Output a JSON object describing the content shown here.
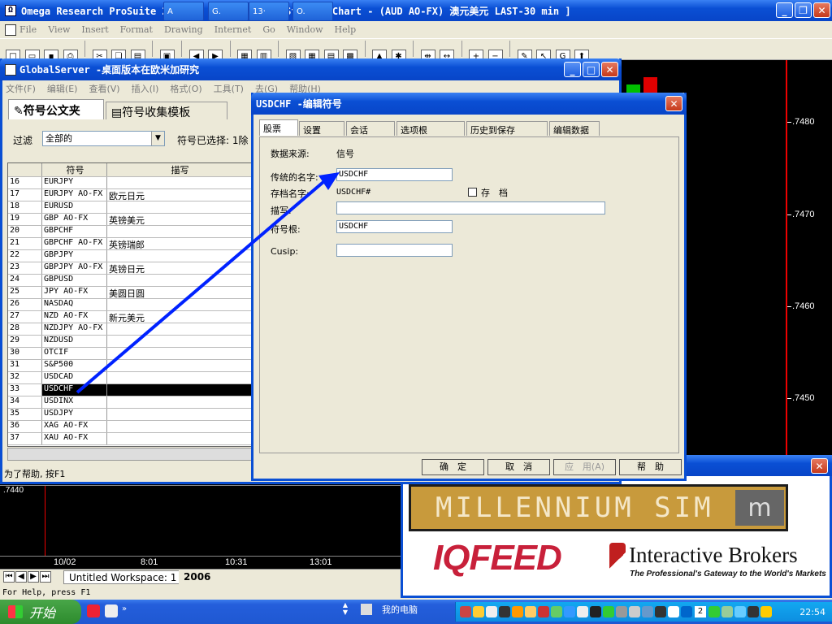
{
  "app": {
    "title": "Omega Research ProSuite 2000i - 2006 - [TradeStation Chart - (AUD AO-FX) 澳元美元 LAST-30 min ]",
    "menu": [
      "File",
      "View",
      "Insert",
      "Format",
      "Drawing",
      "Internet",
      "Go",
      "Window",
      "Help"
    ]
  },
  "chart": {
    "y_labels": [
      ".7480",
      ".7470",
      ".7460",
      ".7450"
    ],
    "lower_label": ".7440",
    "x_labels": [
      "10/02",
      "8:01",
      "10:31",
      "13:01"
    ],
    "up_color": "#00c000",
    "down_color": "#e00000"
  },
  "workspace_tabs": [
    "Untitled Workspace: 1",
    "2006"
  ],
  "status": {
    "left": "For Help, press F1"
  },
  "globalserver": {
    "title": "GlobalServer -桌面版本在欧米加研究",
    "menu": [
      "文件(F)",
      "编辑(E)",
      "查看(V)",
      "插入(I)",
      "格式(O)",
      "工具(T)",
      "去(G)",
      "帮助(H)"
    ],
    "tabs": [
      "符号公文夹",
      "符号收集模板"
    ],
    "filter_label": "过滤",
    "filter_value": "全部的",
    "selected_label": "符号已选择: 1除",
    "columns": [
      "符号",
      "描写"
    ],
    "rows": [
      {
        "n": "16",
        "s": "EURJPY",
        "d": ""
      },
      {
        "n": "17",
        "s": "EURJPY AO-FX",
        "d": "欧元日元"
      },
      {
        "n": "18",
        "s": "EURUSD",
        "d": ""
      },
      {
        "n": "19",
        "s": "GBP AO-FX",
        "d": "英镑美元"
      },
      {
        "n": "20",
        "s": "GBPCHF",
        "d": ""
      },
      {
        "n": "21",
        "s": "GBPCHF AO-FX",
        "d": "英镑瑞郎"
      },
      {
        "n": "22",
        "s": "GBPJPY",
        "d": ""
      },
      {
        "n": "23",
        "s": "GBPJPY AO-FX",
        "d": "英镑日元"
      },
      {
        "n": "24",
        "s": "GBPUSD",
        "d": ""
      },
      {
        "n": "25",
        "s": "JPY AO-FX",
        "d": "美圆日圆"
      },
      {
        "n": "26",
        "s": "NASDAQ",
        "d": ""
      },
      {
        "n": "27",
        "s": "NZD AO-FX",
        "d": "新元美元"
      },
      {
        "n": "28",
        "s": "NZDJPY AO-FX",
        "d": ""
      },
      {
        "n": "29",
        "s": "NZDUSD",
        "d": ""
      },
      {
        "n": "30",
        "s": "OTCIF",
        "d": ""
      },
      {
        "n": "31",
        "s": "S&P500",
        "d": ""
      },
      {
        "n": "32",
        "s": "USDCAD",
        "d": ""
      },
      {
        "n": "33",
        "s": "USDCHF",
        "d": ""
      },
      {
        "n": "34",
        "s": "USDINX",
        "d": ""
      },
      {
        "n": "35",
        "s": "USDJPY",
        "d": ""
      },
      {
        "n": "36",
        "s": "XAG AO-FX",
        "d": ""
      },
      {
        "n": "37",
        "s": "XAU AO-FX",
        "d": ""
      }
    ],
    "selected_index": 17,
    "status": "为了帮助, 按F1"
  },
  "dialog": {
    "title": "USDCHF -编辑符号",
    "tabs": [
      "股票",
      "设置",
      "会话",
      "选项根",
      "历史到保存",
      "编辑数据"
    ],
    "fields": {
      "source_label": "数据来源:",
      "source_value": "信号",
      "name_label": "传统的名字:",
      "name_value": "USDCHF",
      "archive_label": "存档名字:",
      "archive_value": "USDCHF#",
      "save_label": "存　档",
      "desc_label": "描写:",
      "desc_value": "",
      "root_label": "符号根:",
      "root_value": "USDCHF",
      "cusip_label": "Cusip:",
      "cusip_value": ""
    },
    "buttons": [
      "确　定",
      "取　消",
      "应　用(A)",
      "帮　助"
    ]
  },
  "ad": {
    "banner": "MILLENNIUM SIM",
    "banner_mark": "m",
    "iqfeed": "IQFEED",
    "ib_name": "Interactive Brokers",
    "ib_tagline": "The Professional's Gateway to the World's Markets"
  },
  "taskbar": {
    "start": "开始",
    "items": [
      "A",
      "G.",
      "13·",
      "O."
    ],
    "mycomputer": "我的电脑",
    "badge": "2",
    "time": "22:54"
  }
}
